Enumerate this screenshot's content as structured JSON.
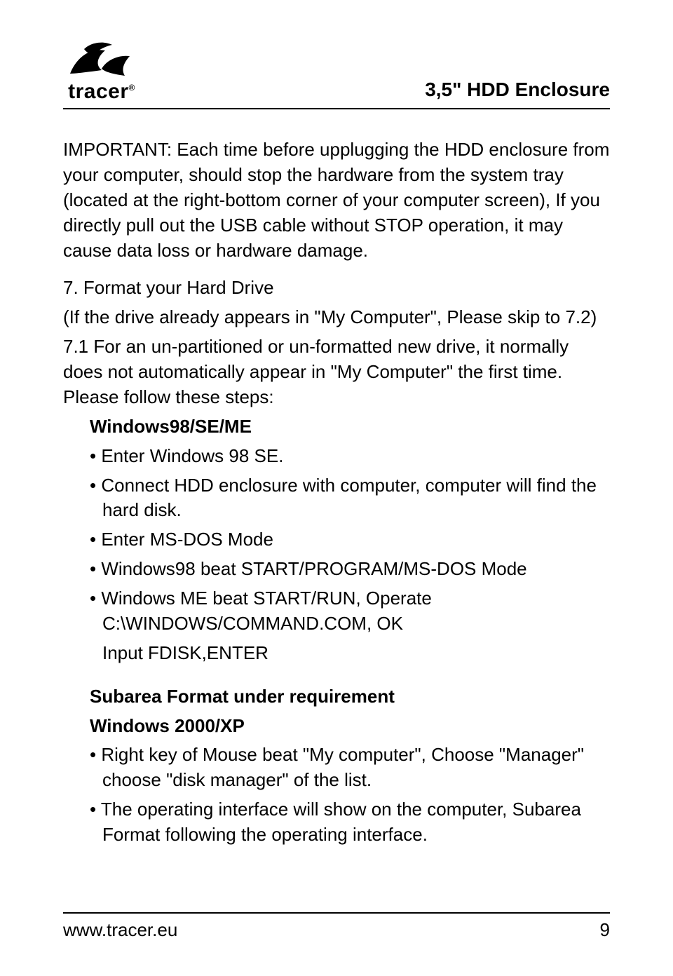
{
  "header": {
    "logo_brand": "tracer",
    "title": "3,5\" HDD Enclosure"
  },
  "body": {
    "important": "IMPORTANT: Each time before upplugging the HDD enclosure from your computer, should stop the hardware from the system tray (located at the right-bottom corner of your computer screen), If you directly pull out the USB cable without STOP operation, it may cause data loss or hardware damage.",
    "sec7_title": "7. Format your Hard Drive",
    "sec7_note": "(If the drive already appears in \"My Computer\", Please skip to 7.2)",
    "sec71": "7.1 For an un-partitioned or un-formatted new drive, it normally does not automatically appear in \"My Computer\" the first time. Please follow these steps:",
    "win98_head": "Windows98/SE/ME",
    "win98_bullets": [
      "• Enter Windows 98 SE.",
      "• Connect HDD enclosure with computer, computer will find the hard disk.",
      "• Enter MS-DOS Mode",
      "• Windows98 beat START/PROGRAM/MS-DOS Mode",
      "• Windows ME beat START/RUN, Operate C:\\WINDOWS/COMMAND.COM, OK"
    ],
    "fdisk_line": "Input FDISK,ENTER",
    "subarea_head": "Subarea Format under requirement",
    "win2k_head": "Windows 2000/XP",
    "win2k_bullets": [
      "• Right key of Mouse beat \"My computer\", Choose \"Manager\" choose \"disk manager\" of the list.",
      "• The operating interface will show on the computer, Subarea Format following the operating interface."
    ]
  },
  "footer": {
    "url": "www.tracer.eu",
    "page": "9"
  }
}
